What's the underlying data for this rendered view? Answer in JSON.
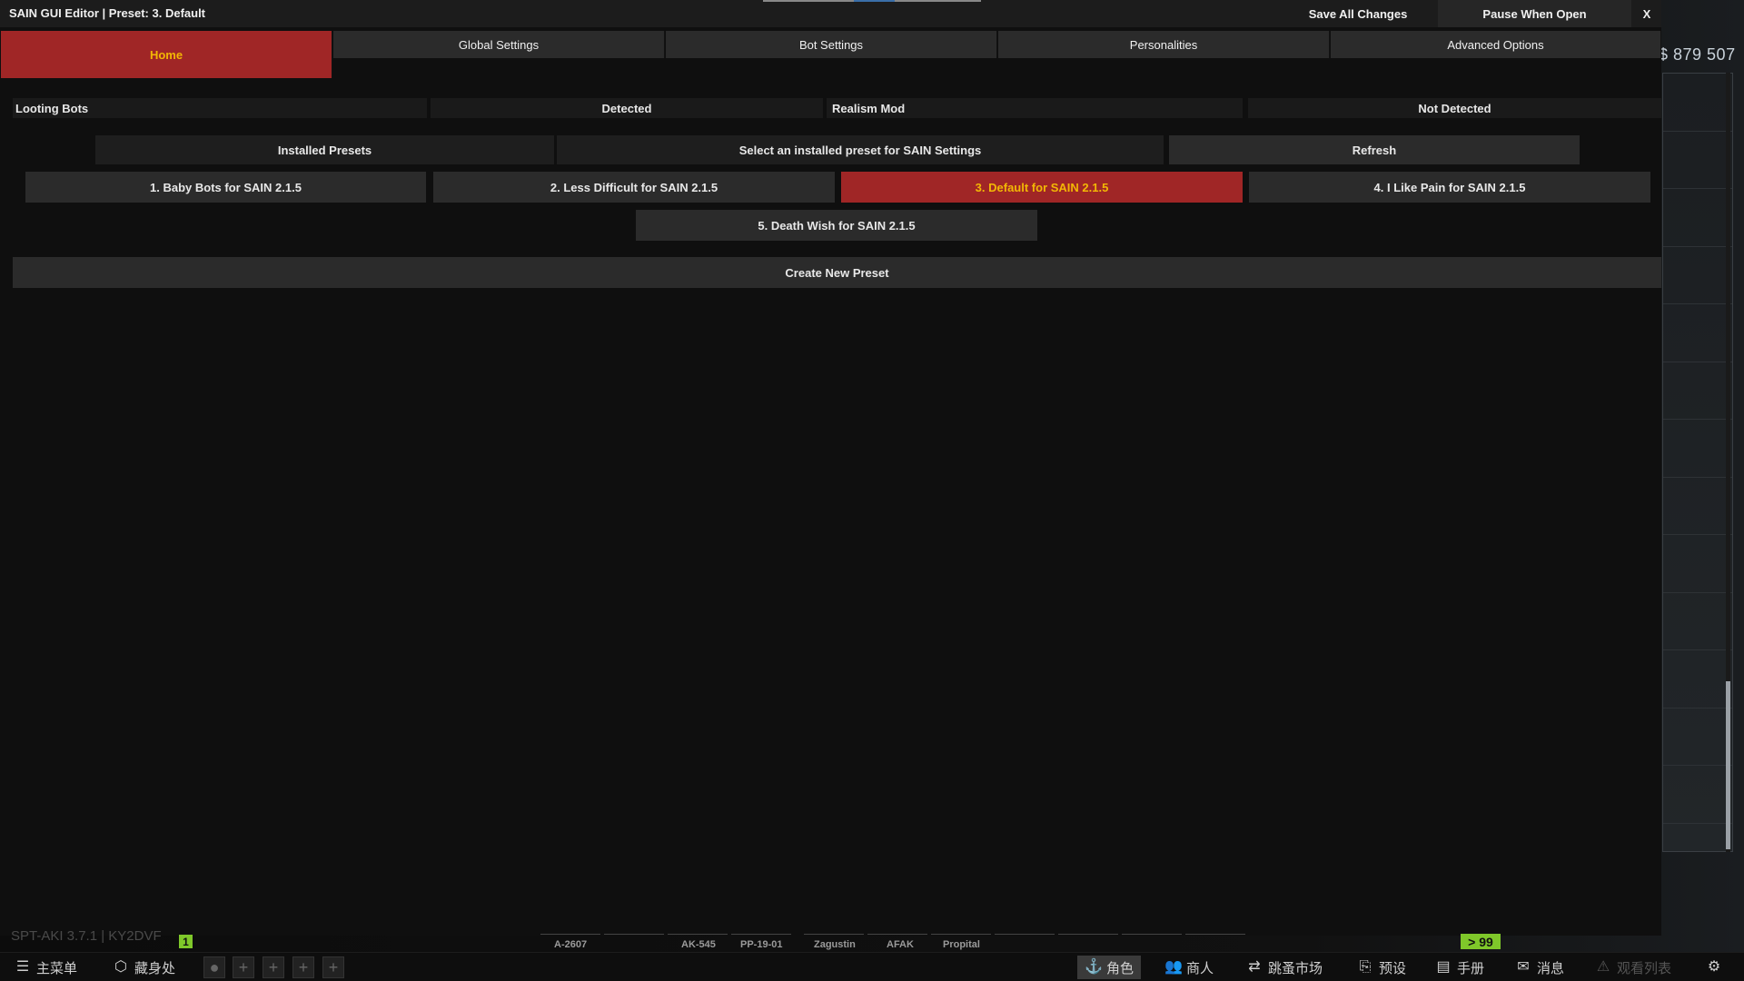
{
  "window": {
    "title": "SAIN GUI Editor | Preset: 3. Default",
    "save_all": "Save All Changes",
    "pause_when_open": "Pause When Open",
    "close": "X"
  },
  "tabs": [
    {
      "label": "Home",
      "active": true
    },
    {
      "label": "Global Settings",
      "active": false
    },
    {
      "label": "Bot Settings",
      "active": false
    },
    {
      "label": "Personalities",
      "active": false
    },
    {
      "label": "Advanced Options",
      "active": false
    }
  ],
  "mods": {
    "looting_bots_label": "Looting Bots",
    "looting_bots_status": "Detected",
    "realism_label": "Realism Mod",
    "realism_status": "Not Detected"
  },
  "presets": {
    "installed_label": "Installed Presets",
    "instruction": "Select an installed preset for SAIN Settings",
    "refresh": "Refresh",
    "items": [
      {
        "label": "1. Baby Bots for SAIN 2.1.5",
        "selected": false
      },
      {
        "label": "2. Less Difficult for SAIN 2.1.5",
        "selected": false
      },
      {
        "label": "3. Default for SAIN 2.1.5",
        "selected": true
      },
      {
        "label": "4. I Like Pain for SAIN 2.1.5",
        "selected": false
      },
      {
        "label": "5. Death Wish for SAIN 2.1.5",
        "selected": false
      }
    ],
    "create_new": "Create New Preset"
  },
  "game": {
    "money": "$ 879 507",
    "version": "SPT-AKI 3.7.1 | KY2DVF",
    "level_badge": "1",
    "right_badge": "> 99",
    "slots": [
      "A-2607",
      "",
      "AK-545",
      "PP-19-01",
      "Zagustin",
      "AFAK",
      "Propital"
    ],
    "bottom_nav": {
      "main_menu": "主菜单",
      "hideout": "藏身处",
      "character": "角色",
      "traders": "商人",
      "flea_market": "跳蚤市场",
      "presets": "预设",
      "handbook": "手册",
      "messages": "消息",
      "watchlist": "观看列表"
    }
  },
  "colors": {
    "accent_red": "#a02626",
    "active_text": "#f2b705",
    "button_gray": "#2b2b2b",
    "badge_green": "#7fc82a"
  }
}
